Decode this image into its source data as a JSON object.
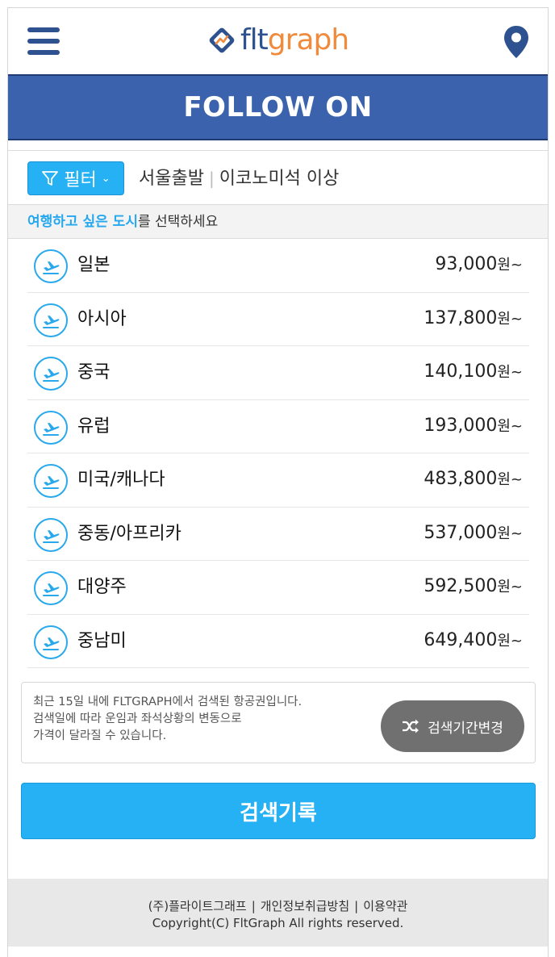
{
  "header": {
    "logo_flt": "flt",
    "logo_graph": "graph",
    "menu_icon": "hamburger-menu-icon",
    "location_icon": "map-pin-icon"
  },
  "banner": {
    "title": "FOLLOW ON"
  },
  "filter": {
    "button_label": "필터",
    "departure": "서울출발",
    "cabin": "이코노미석 이상"
  },
  "hint": {
    "highlight": "여행하고 싶은 도시",
    "rest": "를 선택하세요"
  },
  "destinations": [
    {
      "name": "일본",
      "price": "93,000",
      "unit": "원~"
    },
    {
      "name": "아시아",
      "price": "137,800",
      "unit": "원~"
    },
    {
      "name": "중국",
      "price": "140,100",
      "unit": "원~"
    },
    {
      "name": "유럽",
      "price": "193,000",
      "unit": "원~"
    },
    {
      "name": "미국/캐나다",
      "price": "483,800",
      "unit": "원~"
    },
    {
      "name": "중동/아프리카",
      "price": "537,000",
      "unit": "원~"
    },
    {
      "name": "대양주",
      "price": "592,500",
      "unit": "원~"
    },
    {
      "name": "중남미",
      "price": "649,400",
      "unit": "원~"
    }
  ],
  "notice": {
    "line1": "최근 15일 내에 FLTGRAPH에서 검색된 항공권입니다.",
    "line2": "검색일에 따라 운임과 좌석상황의 변동으로",
    "line3": "가격이 달라질 수 있습니다.",
    "period_button": "검색기간변경"
  },
  "history_button": "검색기록",
  "footer": {
    "company": "(주)플라이트그래프",
    "privacy": "개인정보취급방침",
    "terms": "이용약관",
    "copyright": "Copyright(C) FltGraph All rights reserved."
  },
  "colors": {
    "header_blue": "#3b62ac",
    "brand_navy": "#2e5290",
    "brand_orange": "#f08a3c",
    "accent_blue": "#25b1f4",
    "gray_button": "#707070"
  }
}
